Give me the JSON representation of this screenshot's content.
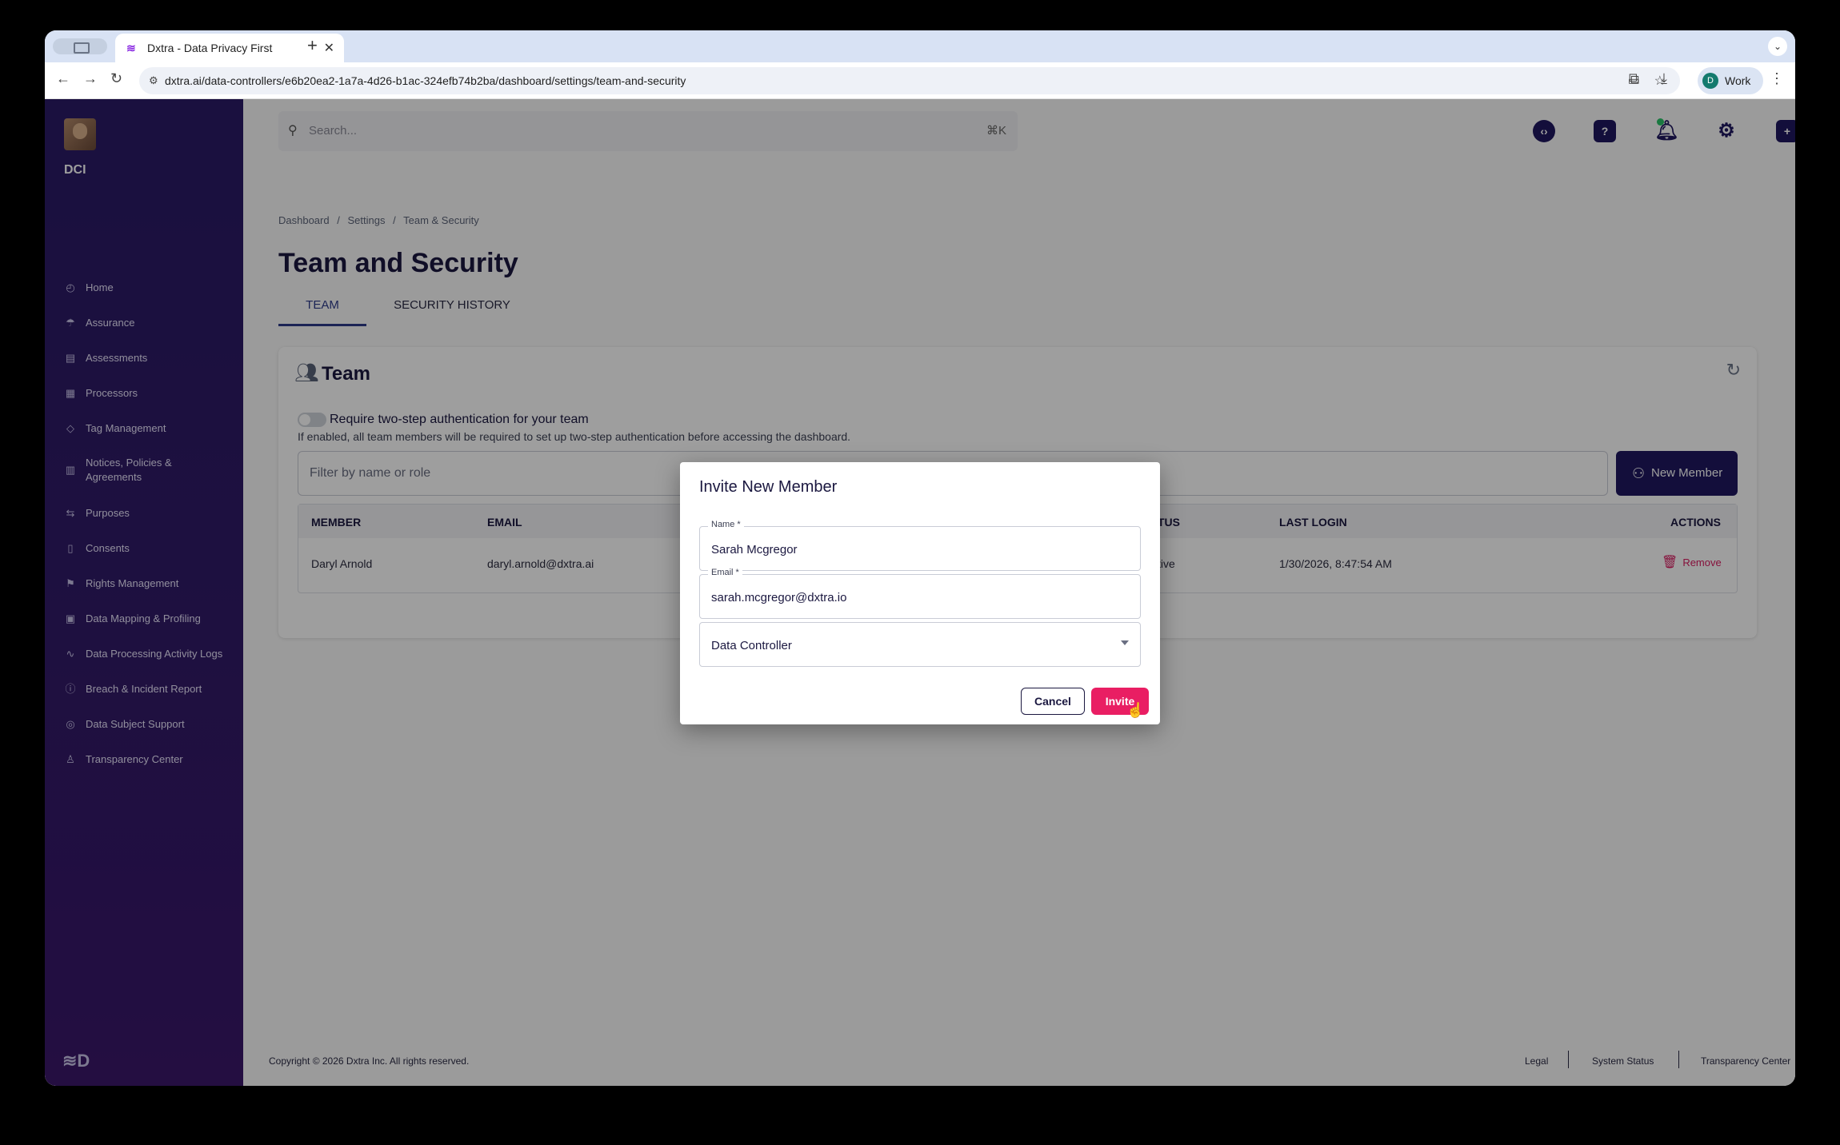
{
  "browser": {
    "tab_title": "Dxtra - Data Privacy First",
    "url": "dxtra.ai/data-controllers/e6b20ea2-1a7a-4d26-b1ac-324efb74b2ba/dashboard/settings/team-and-security",
    "profile_initial": "D",
    "profile_label": "Work"
  },
  "sidebar": {
    "org": "DCI",
    "items": [
      {
        "label": "Home",
        "icon": "home-icon"
      },
      {
        "label": "Assurance",
        "icon": "assurance-icon"
      },
      {
        "label": "Assessments",
        "icon": "assessments-icon"
      },
      {
        "label": "Processors",
        "icon": "processors-icon"
      },
      {
        "label": "Tag Management",
        "icon": "tag-icon"
      },
      {
        "label": "Notices, Policies & Agreements",
        "icon": "document-icon"
      },
      {
        "label": "Purposes",
        "icon": "purposes-icon"
      },
      {
        "label": "Consents",
        "icon": "consents-icon"
      },
      {
        "label": "Rights Management",
        "icon": "flag-icon"
      },
      {
        "label": "Data Mapping & Profiling",
        "icon": "mapping-icon"
      },
      {
        "label": "Data Processing Activity Logs",
        "icon": "activity-icon"
      },
      {
        "label": "Breach & Incident Report",
        "icon": "alert-icon"
      },
      {
        "label": "Data Subject Support",
        "icon": "support-icon"
      },
      {
        "label": "Transparency Center",
        "icon": "transparency-icon"
      }
    ]
  },
  "topbar": {
    "search_placeholder": "Search...",
    "shortcut": "⌘K"
  },
  "breadcrumb": [
    "Dashboard",
    "/",
    "Settings",
    "/",
    "Team & Security"
  ],
  "page_title": "Team and Security",
  "tabs": [
    {
      "label": "TEAM",
      "active": true
    },
    {
      "label": "SECURITY HISTORY",
      "active": false
    }
  ],
  "team_card": {
    "title": "Team",
    "two_step_label": "Require two-step authentication for your team",
    "two_step_description": "If enabled, all team members will be required to set up two-step authentication before accessing the dashboard.",
    "filter_placeholder": "Filter by name or role",
    "new_member_label": "New Member",
    "columns": [
      "MEMBER",
      "EMAIL",
      "TUS",
      "LAST LOGIN",
      "ACTIONS"
    ],
    "rows": [
      {
        "member": "Daryl Arnold",
        "email": "daryl.arnold@dxtra.ai",
        "status": "tive",
        "last_login": "1/30/2026, 8:47:54 AM",
        "action": "Remove"
      }
    ]
  },
  "footer": {
    "copyright": "Copyright © 2026 Dxtra Inc. All rights reserved.",
    "links": [
      "Legal",
      "System Status",
      "Transparency Center"
    ]
  },
  "modal": {
    "title": "Invite New Member",
    "name_label": "Name *",
    "name_value": "Sarah Mcgregor",
    "email_label": "Email *",
    "email_value": "sarah.mcgregor@dxtra.io",
    "role_value": "Data Controller",
    "cancel_label": "Cancel",
    "invite_label": "Invite"
  },
  "colors": {
    "primary": "#1f1860",
    "accent": "#e91e63",
    "sidebar": "#2a1a66"
  }
}
